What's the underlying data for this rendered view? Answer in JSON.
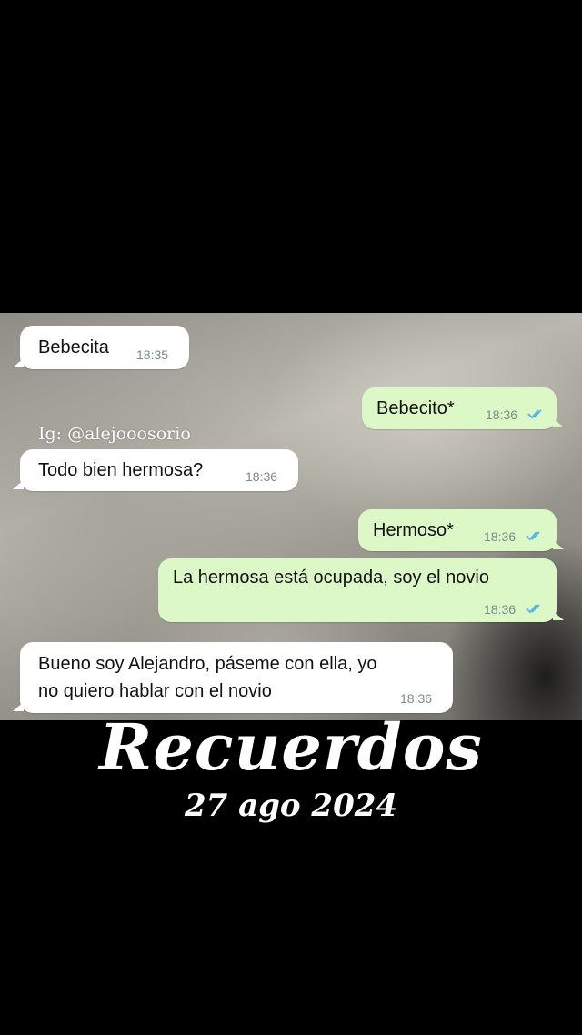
{
  "watermark": "Ig: @alejooosorio",
  "messages": [
    {
      "text": "Bebecita",
      "time": "18:35",
      "direction": "incoming"
    },
    {
      "text": "Bebecito*",
      "time": "18:36",
      "direction": "outgoing",
      "read": true
    },
    {
      "text": "Todo bien hermosa?",
      "time": "18:36",
      "direction": "incoming"
    },
    {
      "text": "Hermoso*",
      "time": "18:36",
      "direction": "outgoing",
      "read": true
    },
    {
      "text": "La hermosa está ocupada, soy el novio",
      "time": "18:36",
      "direction": "outgoing",
      "read": true
    },
    {
      "text_line1": "Bueno soy Alejandro, páseme con ella, yo",
      "text_line2": "no quiero hablar con el novio",
      "time": "18:36",
      "direction": "incoming"
    }
  ],
  "caption": {
    "title": "Recuerdos",
    "date": "27 ago 2024"
  },
  "colors": {
    "incoming_bubble": "#ffffff",
    "outgoing_bubble": "#dcf8c6",
    "read_ticks": "#4fb6ec",
    "background": "#000000"
  }
}
